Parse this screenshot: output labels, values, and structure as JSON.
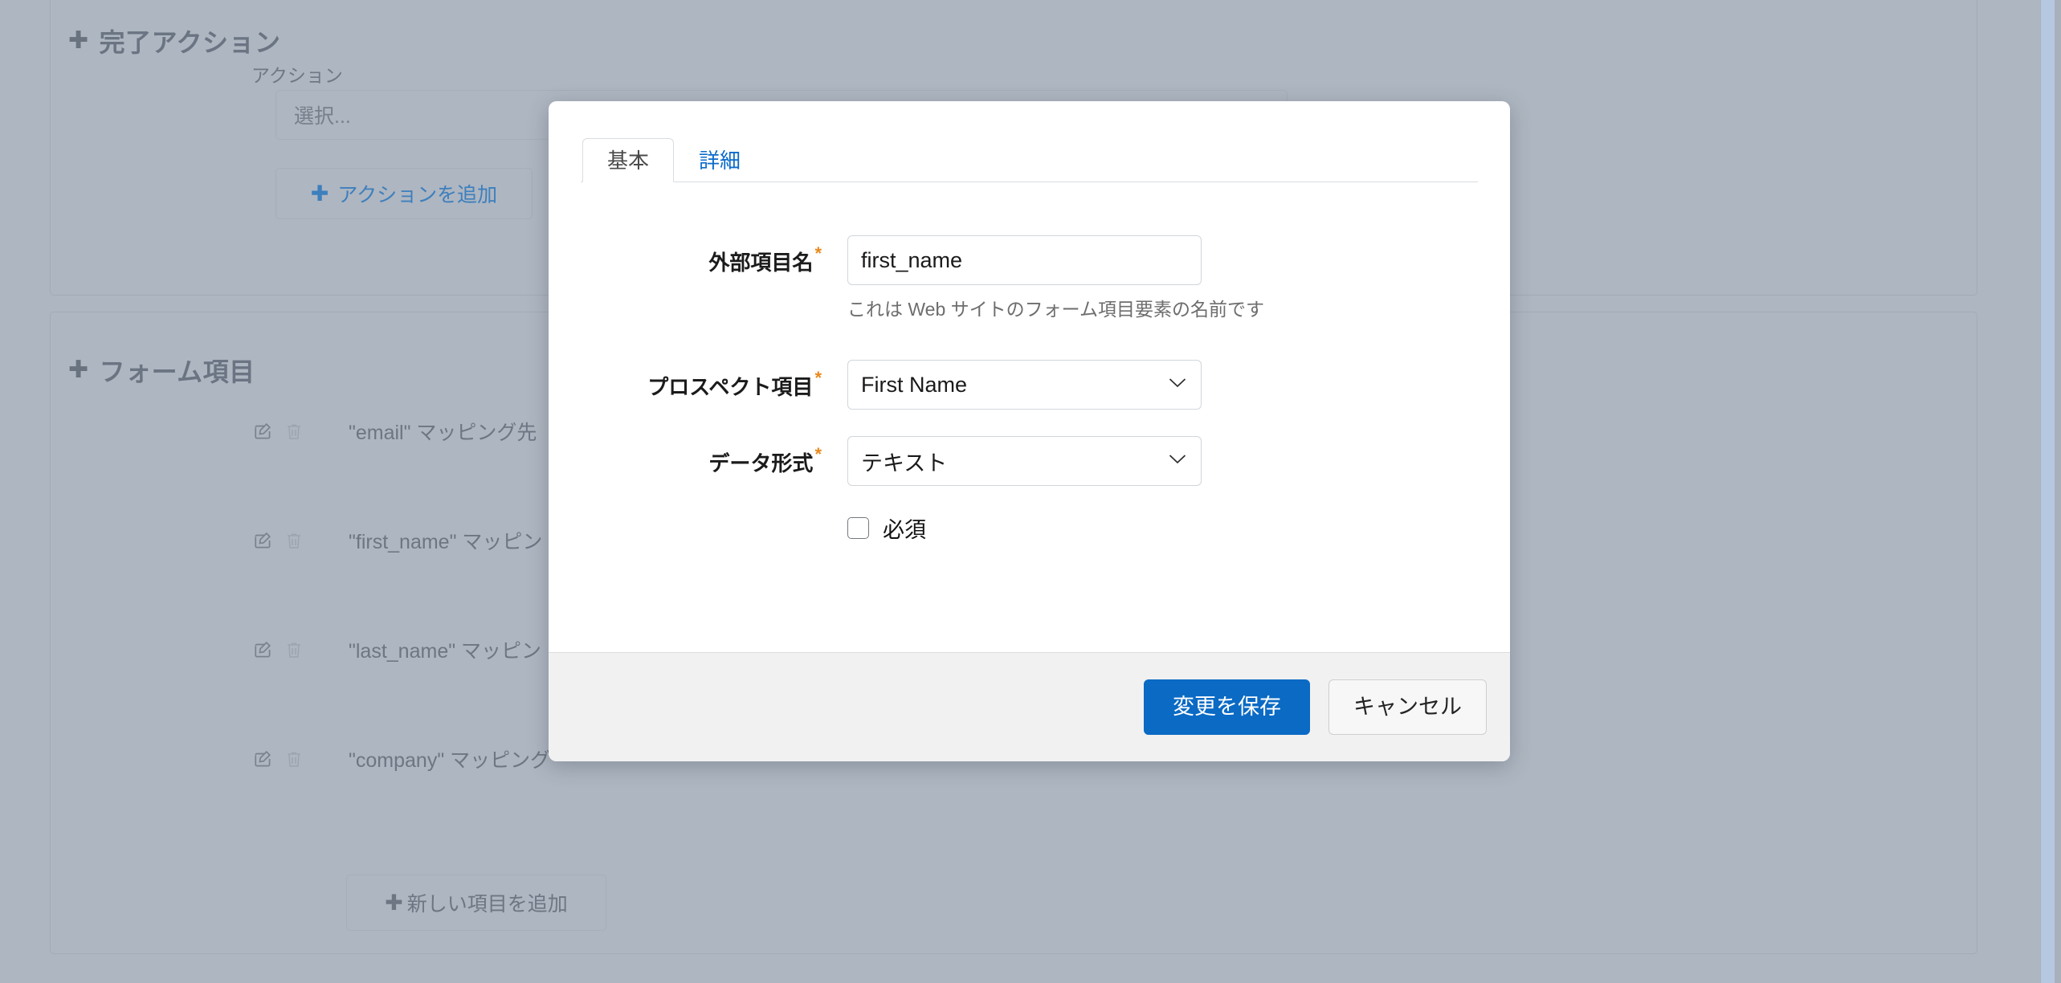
{
  "background": {
    "panels": [
      {
        "title": "完了アクション",
        "field_label": "アクション",
        "select_placeholder": "選択...",
        "buttons": [
          {
            "label": "アクションを追加",
            "icon": "plus-icon"
          },
          {
            "label": "",
            "icon": "plus-icon"
          }
        ]
      },
      {
        "title": "フォーム項目",
        "rows": [
          {
            "text": "\"email\" マッピング先",
            "edit_icon": "edit-pencil-icon",
            "delete_icon": "trash-icon"
          },
          {
            "text": "\"first_name\" マッピン",
            "edit_icon": "edit-pencil-icon",
            "delete_icon": "trash-icon"
          },
          {
            "text": "\"last_name\" マッピン",
            "edit_icon": "edit-pencil-icon",
            "delete_icon": "trash-icon"
          },
          {
            "text": "\"company\" マッピング",
            "edit_icon": "edit-pencil-icon",
            "delete_icon": "trash-icon"
          }
        ],
        "add_button": {
          "label": "新しい項目を追加",
          "icon": "plus-icon"
        }
      }
    ]
  },
  "modal": {
    "tabs": [
      {
        "label": "基本",
        "active": true
      },
      {
        "label": "詳細",
        "active": false
      }
    ],
    "fields": {
      "external_name": {
        "label": "外部項目名",
        "required_marker": "*",
        "value": "first_name",
        "placeholder": "",
        "help": "これは Web サイトのフォーム項目要素の名前です"
      },
      "prospect_field": {
        "label": "プロスペクト項目",
        "required_marker": "*",
        "value": "First Name"
      },
      "data_format": {
        "label": "データ形式",
        "required_marker": "*",
        "value": "テキスト"
      },
      "required_checkbox": {
        "label": "必須",
        "checked": false
      }
    },
    "footer": {
      "save_label": "変更を保存",
      "cancel_label": "キャンセル"
    }
  },
  "colors": {
    "primary_button": "#0a6ac4",
    "tab_link": "#0c6bc9",
    "required_star": "#e8891d",
    "backdrop": "#aeb6c1",
    "footer_bg": "#f1f1f1",
    "scrollbar_thumb": "#b6c7e2"
  }
}
